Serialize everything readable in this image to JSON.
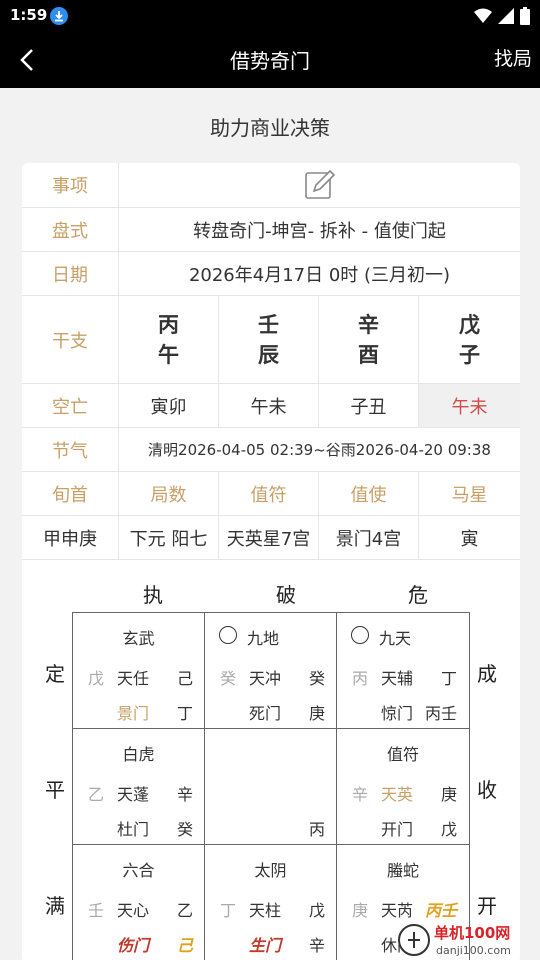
{
  "status": {
    "time": "1:59"
  },
  "appbar": {
    "title": "借势奇门",
    "action": "找局"
  },
  "page_title": "助力商业决策",
  "rows": {
    "shixiang": "事项",
    "panshi_label": "盘式",
    "panshi_value": "转盘奇门-坤宫- 拆补 - 值使门起",
    "riqi_label": "日期",
    "riqi_value": "2026年4月17日 0时 (三月初一)",
    "ganzhi_label": "干支",
    "ganzhi": [
      {
        "top": "丙",
        "bottom": "午"
      },
      {
        "top": "壬",
        "bottom": "辰"
      },
      {
        "top": "辛",
        "bottom": "酉"
      },
      {
        "top": "戊",
        "bottom": "子"
      }
    ],
    "kongwang_label": "空亡",
    "kongwang": [
      "寅卯",
      "午未",
      "子丑",
      "午未"
    ],
    "jieqi_label": "节气",
    "jieqi_value": "清明2026-04-05 02:39~谷雨2026-04-20 09:38",
    "headers": [
      "旬首",
      "局数",
      "值符",
      "值使",
      "马星"
    ],
    "values": [
      "甲申庚",
      "下元 阳七",
      "天英星7宫",
      "景门4宫",
      "寅"
    ]
  },
  "chart": {
    "top_labels": [
      "执",
      "破",
      "危"
    ],
    "left_labels": [
      "定",
      "平",
      "满"
    ],
    "right_labels": [
      "成",
      "收",
      "开"
    ],
    "palaces": [
      {
        "god": "玄武",
        "circle": false,
        "a": "戊",
        "star": "天任",
        "b": "己",
        "door": "景门",
        "c": "丁"
      },
      {
        "god": "九地",
        "circle": true,
        "a": "癸",
        "star": "天冲",
        "b": "癸",
        "door": "死门",
        "c": "庚"
      },
      {
        "god": "九天",
        "circle": true,
        "a": "丙",
        "star": "天辅",
        "b": "丁",
        "door": "惊门",
        "c": "丙壬"
      },
      {
        "god": "白虎",
        "circle": false,
        "a": "乙",
        "star": "天蓬",
        "b": "辛",
        "door": "杜门",
        "c": "癸"
      },
      {
        "god": "",
        "circle": false,
        "a": "",
        "star": "",
        "b": "",
        "door": "",
        "c": "丙"
      },
      {
        "god": "值符",
        "circle": false,
        "a": "辛",
        "star": "天英",
        "b": "庚",
        "door": "开门",
        "c": "戊"
      },
      {
        "god": "六合",
        "circle": false,
        "a": "壬",
        "star": "天心",
        "b": "乙",
        "door": "伤门",
        "c": "己"
      },
      {
        "god": "太阴",
        "circle": false,
        "a": "丁",
        "star": "天柱",
        "b": "戊",
        "door": "生门",
        "c": "辛"
      },
      {
        "god": "螣蛇",
        "circle": false,
        "a": "庚",
        "star": "天芮",
        "b": "丙壬",
        "door": "休门",
        "c": ""
      }
    ]
  },
  "watermark": {
    "text": "单机100网",
    "sub": "danji100.com"
  }
}
